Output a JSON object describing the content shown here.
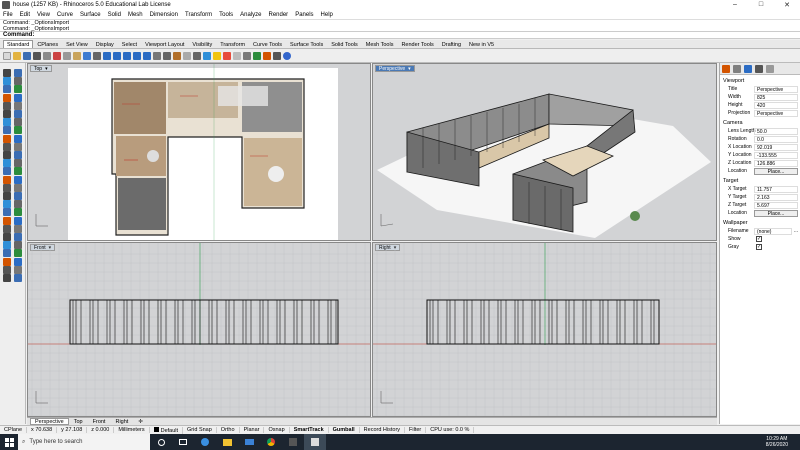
{
  "window": {
    "title": "house (1257 KB) - Rhinoceros 5.0 Educational Lab License",
    "min_glyph": "–",
    "max_glyph": "□",
    "close_glyph": "✕"
  },
  "menu": [
    "File",
    "Edit",
    "View",
    "Curve",
    "Surface",
    "Solid",
    "Mesh",
    "Dimension",
    "Transform",
    "Tools",
    "Analyze",
    "Render",
    "Panels",
    "Help"
  ],
  "command": {
    "history": [
      "Command: _OptionsImport",
      "Command: _OptionsImport"
    ],
    "prompt": "Command:"
  },
  "toolbar_tabs": [
    "Standard",
    "CPlanes",
    "Set View",
    "Display",
    "Select",
    "Viewport Layout",
    "Visibility",
    "Transform",
    "Curve Tools",
    "Surface Tools",
    "Solid Tools",
    "Mesh Tools",
    "Render Tools",
    "Drafting",
    "New in V5"
  ],
  "viewports": {
    "top": "Top",
    "perspective": "Perspective",
    "front": "Front",
    "right": "Right",
    "menu_glyph": "▾"
  },
  "viewport_tabs": [
    "Perspective",
    "Top",
    "Front",
    "Right",
    "✛"
  ],
  "panel": {
    "viewport_section": "Viewport",
    "viewport_rows": [
      {
        "label": "Title",
        "value": "Perspective"
      },
      {
        "label": "Width",
        "value": "825"
      },
      {
        "label": "Height",
        "value": "420"
      },
      {
        "label": "Projection",
        "value": "Perspective"
      }
    ],
    "camera_section": "Camera",
    "camera_rows": [
      {
        "label": "Lens Length",
        "value": "50.0"
      },
      {
        "label": "Rotation",
        "value": "0.0"
      },
      {
        "label": "X Location",
        "value": "92.019"
      },
      {
        "label": "Y Location",
        "value": "-133.555"
      },
      {
        "label": "Z Location",
        "value": "126.886"
      }
    ],
    "camera_place_label": "Location",
    "place_button": "Place...",
    "target_section": "Target",
    "target_rows": [
      {
        "label": "X Target",
        "value": "11.757"
      },
      {
        "label": "Y Target",
        "value": "2.163"
      },
      {
        "label": "Z Target",
        "value": "5.697"
      }
    ],
    "target_place_label": "Location",
    "wallpaper_section": "Wallpaper",
    "filename_label": "Filename",
    "filename_value": "(none)",
    "show_label": "Show",
    "gray_label": "Gray",
    "check_glyph": "✓",
    "more_glyph": "..."
  },
  "status": {
    "cplane": "CPlane",
    "x": "x 70.638",
    "y": "y 27.108",
    "z": "z 0.000",
    "units": "Millimeters",
    "layer": "Default",
    "toggles": [
      "Grid Snap",
      "Ortho",
      "Planar",
      "Osnap",
      "SmartTrack",
      "Gumball",
      "Record History",
      "Filter"
    ],
    "cpu": "CPU use: 0.0 %"
  },
  "taskbar": {
    "search_placeholder": "Type here to search",
    "time": "10:29 AM",
    "date": "8/26/2020"
  },
  "colors": {
    "active_tab": "#4a79b5",
    "viewport_bg": "#d2d3d5",
    "taskbar": "#1c2530",
    "axis_red": "#c0392b",
    "axis_green": "#2e9e4f"
  }
}
